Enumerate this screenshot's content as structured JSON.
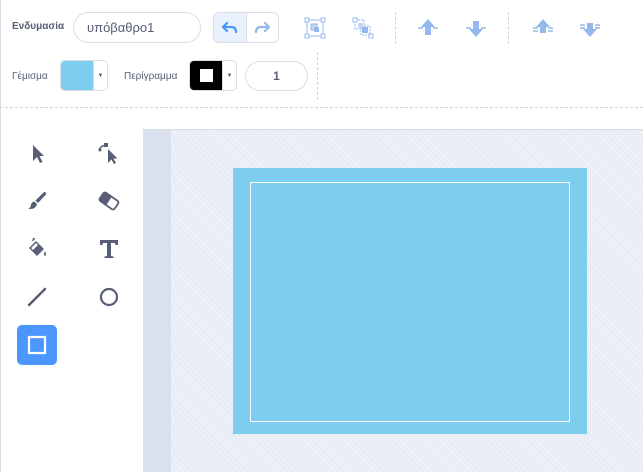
{
  "toolbar": {
    "costume_label": "Ενδυμασία",
    "costume_name": "υπόβαθρο1",
    "fill_label": "Γέμισμα",
    "fill_color": "#7dcdef",
    "outline_label": "Περίγραμμα",
    "outline_color": "#000000",
    "outline_width": "1"
  },
  "icons": {
    "undo": "undo-icon",
    "redo": "redo-icon",
    "group": "group-icon",
    "ungroup": "ungroup-icon",
    "forward": "forward-icon",
    "backward": "backward-icon",
    "front": "front-icon",
    "back": "back-icon"
  },
  "tools": [
    "select",
    "reshape",
    "brush",
    "eraser",
    "fill",
    "text",
    "line",
    "circle",
    "rectangle"
  ],
  "selected_tool": "rectangle",
  "canvas": {
    "shape_fill": "#7dcdef",
    "shape_outline": "#ffffff"
  },
  "colors": {
    "accent": "#4c97ff",
    "icon": "#575e75",
    "disabled_icon": "#93b8ec"
  }
}
